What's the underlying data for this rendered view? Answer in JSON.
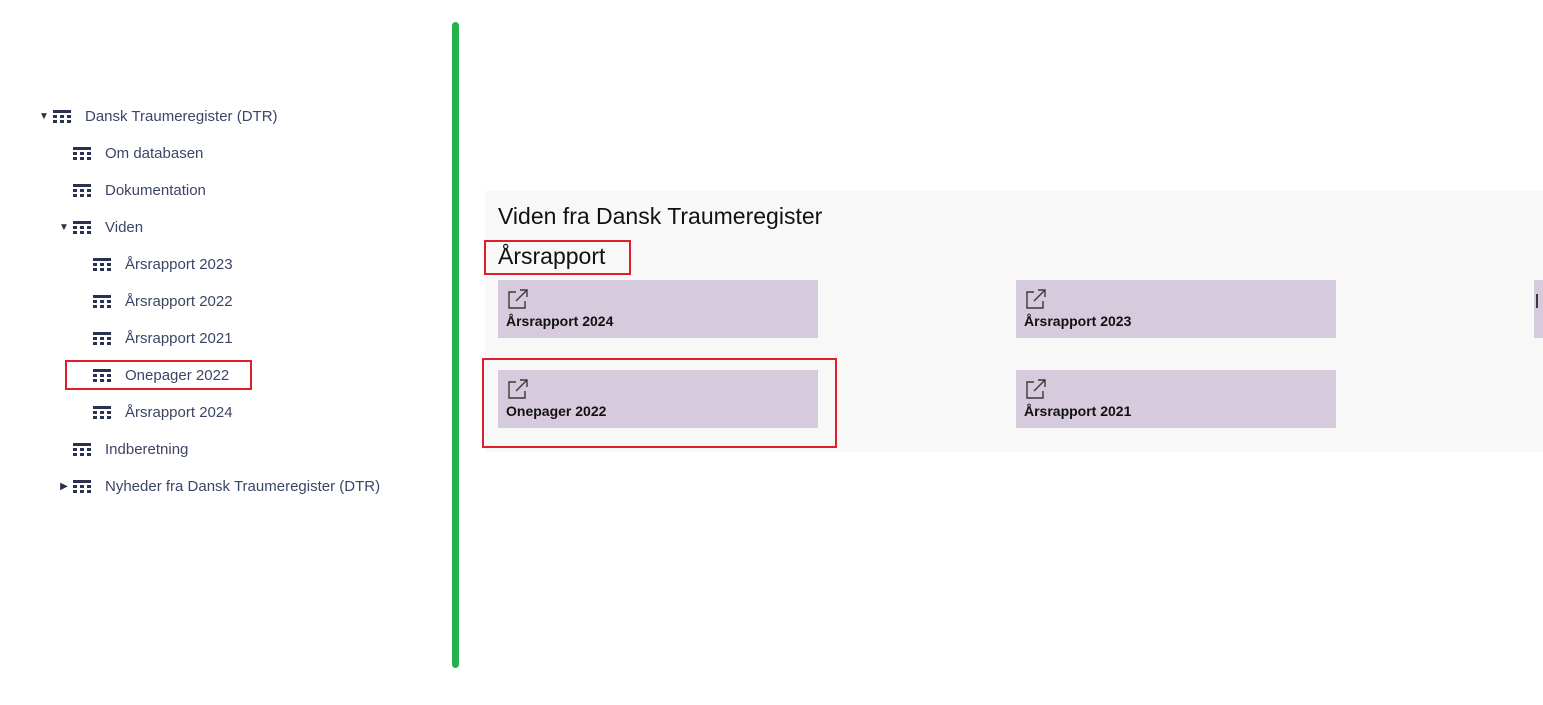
{
  "tree": {
    "items": [
      {
        "label": "Dansk Traumeregister (DTR)",
        "level": 0,
        "caret": "expanded"
      },
      {
        "label": "Om databasen",
        "level": 1,
        "caret": "none"
      },
      {
        "label": "Dokumentation",
        "level": 1,
        "caret": "none"
      },
      {
        "label": "Viden",
        "level": 1,
        "caret": "expanded"
      },
      {
        "label": "Årsrapport 2023",
        "level": 2,
        "caret": "none"
      },
      {
        "label": "Årsrapport 2022",
        "level": 2,
        "caret": "none"
      },
      {
        "label": "Årsrapport 2021",
        "level": 2,
        "caret": "none"
      },
      {
        "label": "Onepager 2022",
        "level": 2,
        "caret": "none",
        "highlighted": true
      },
      {
        "label": "Årsrapport 2024",
        "level": 2,
        "caret": "none"
      },
      {
        "label": "Indberetning",
        "level": 1,
        "caret": "none"
      },
      {
        "label": "Nyheder fra Dansk Traumeregister (DTR)",
        "level": 1,
        "caret": "collapsed"
      }
    ],
    "icon": "table-grid-icon"
  },
  "panel": {
    "title": "Viden fra Dansk Traumeregister",
    "section_title": "Årsrapport",
    "tiles": [
      {
        "label": "Årsrapport 2024",
        "icon": "external-link-icon"
      },
      {
        "label": "Årsrapport 2023",
        "icon": "external-link-icon"
      },
      {
        "label": "Onepager 2022",
        "icon": "external-link-icon",
        "highlighted": true
      },
      {
        "label": "Årsrapport 2021",
        "icon": "external-link-icon"
      }
    ]
  },
  "colors": {
    "splitter": "#25b14c",
    "highlight": "#e11d2a",
    "tile_bg": "#d5cbdc",
    "panel_bg": "#f8f8f8",
    "tree_text": "#3c4566"
  }
}
